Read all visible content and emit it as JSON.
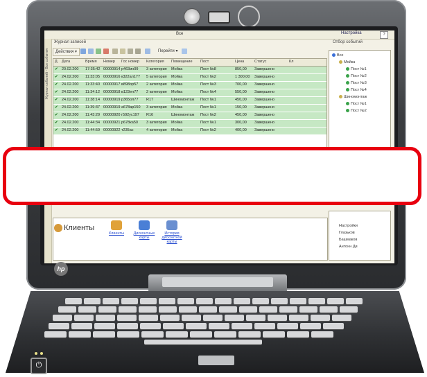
{
  "app": {
    "title": "Все",
    "settings_label": "Настройка",
    "help_label": "?",
    "left_strip_text": "Журнал событий - Все события",
    "journal_label": "Журнал записей",
    "events_label": "Отбор событий",
    "actions_label": "Действия ▾",
    "goto_label": "Перейти ▾"
  },
  "grid": {
    "columns": [
      "Д",
      "Дата",
      "Время",
      "Номер",
      "Гос номер",
      "Категория",
      "Помещение",
      "Пост",
      "Цена",
      "Статус",
      "Кл"
    ],
    "rows": [
      [
        "✔",
        "20.02.200",
        "17:35:42",
        "00000914",
        "р463ин99",
        "3 категория",
        "Мойка",
        "Пост №8",
        "850,00",
        "Завершено"
      ],
      [
        "✔",
        "24.02.200",
        "11:33:05",
        "00000916",
        "к322ал177",
        "5 категория",
        "Мойка",
        "Пост №2",
        "1 300,00",
        "Завершено"
      ],
      [
        "✔",
        "24.02.200",
        "11:33:40",
        "00000917",
        "в898ор57",
        "2 категория",
        "Мойка",
        "Пост №3",
        "700,00",
        "Завершено"
      ],
      [
        "✔",
        "24.02.200",
        "11:34:12",
        "00000918",
        "в123ен77",
        "2 категория",
        "Мойка",
        "Пост №4",
        "550,00",
        "Завершено"
      ],
      [
        "✔",
        "24.02.200",
        "11:38:14",
        "00000919",
        "р365ол77",
        "R17",
        "Шиномонтаж",
        "Пост №1",
        "450,00",
        "Завершено"
      ],
      [
        "✔",
        "24.02.200",
        "11:39:37",
        "00000919",
        "а678ар150",
        "3 категория",
        "Мойка",
        "Пост №1",
        "150,00",
        "Завершено"
      ],
      [
        "✔",
        "24.02.200",
        "11:43:29",
        "00000920",
        "г592ус197",
        "R16",
        "Шиномонтаж",
        "Пост №2",
        "450,00",
        "Завершено"
      ],
      [
        "✔",
        "24.02.200",
        "11:44:34",
        "00000921",
        "р678ка50",
        "3 категория",
        "Мойка",
        "Пост №1",
        "300,00",
        "Завершено"
      ],
      [
        "✔",
        "24.02.200",
        "11:44:59",
        "00000922",
        "т235ас",
        "4 категория",
        "Мойка",
        "Пост №2",
        "400,00",
        "Завершено"
      ]
    ]
  },
  "tree": {
    "nodes": [
      {
        "label": "Все",
        "level": 0,
        "color": "#3a6fd8"
      },
      {
        "label": "Мойка",
        "level": 1,
        "color": "#c9b04d"
      },
      {
        "label": "Пост №1",
        "level": 2,
        "color": "#3aa34a"
      },
      {
        "label": "Пост №2",
        "level": 2,
        "color": "#3aa34a"
      },
      {
        "label": "Пост №3",
        "level": 2,
        "color": "#3aa34a"
      },
      {
        "label": "Пост №4",
        "level": 2,
        "color": "#3aa34a"
      },
      {
        "label": "Шиномонтаж",
        "level": 1,
        "color": "#c9b04d"
      },
      {
        "label": "Пост №1",
        "level": 2,
        "color": "#3aa34a"
      },
      {
        "label": "Пост №2",
        "level": 2,
        "color": "#3aa34a"
      }
    ],
    "nodes2": [
      "Настройки",
      "Глазьков",
      "Башмаков",
      "Антонн Ди"
    ]
  },
  "bottom": {
    "section_title": "Клиенты",
    "items": [
      {
        "label": "Клиенты",
        "color": "#e0a23a"
      },
      {
        "label": "Дисконтные карты",
        "color": "#4a7fd6"
      },
      {
        "label": "История дисконтной карты",
        "color": "#6a8fd0"
      }
    ]
  },
  "laptop": {
    "brand": "hp",
    "power_symbol": "⏻"
  }
}
